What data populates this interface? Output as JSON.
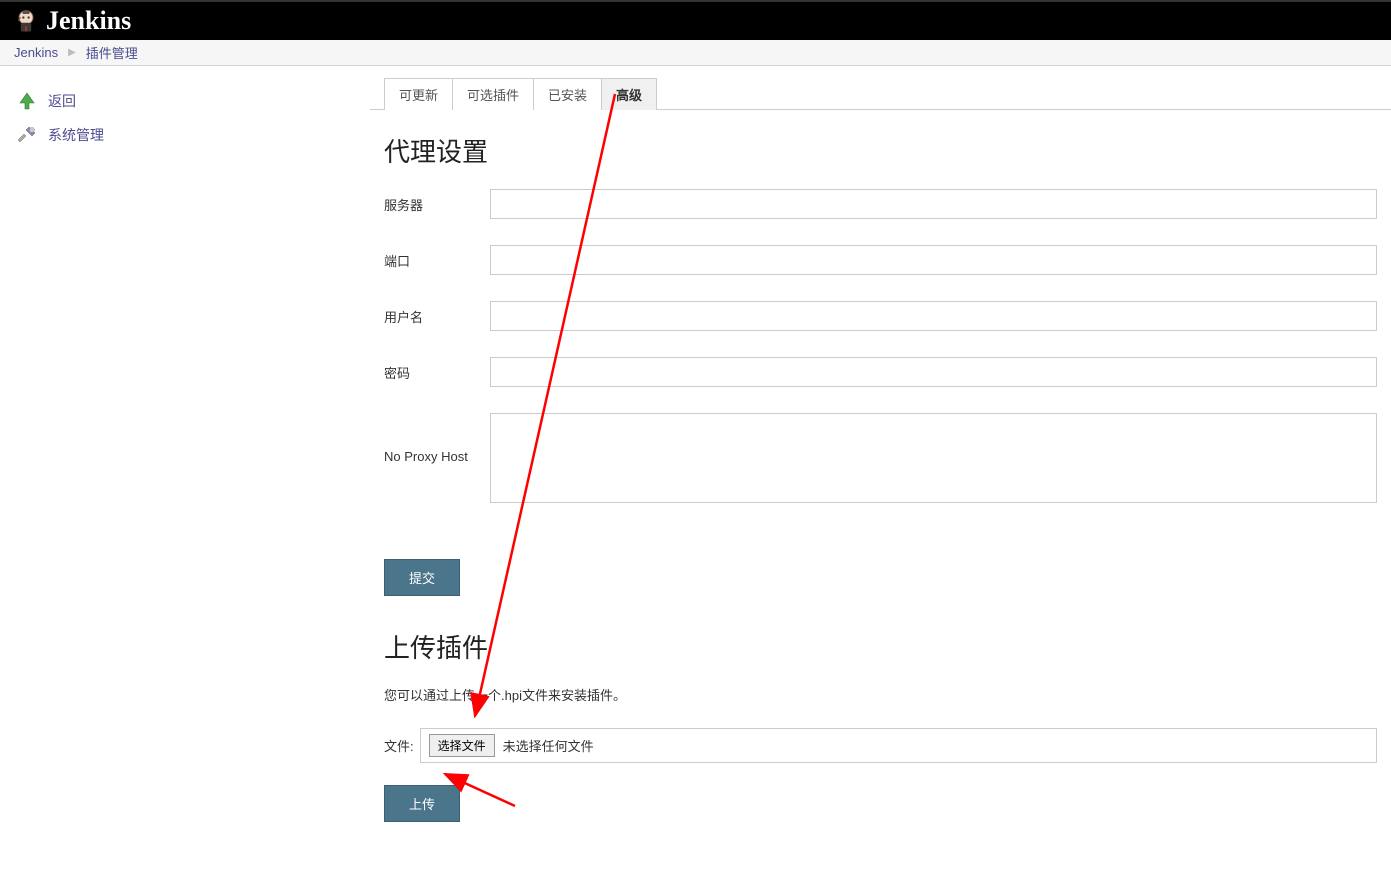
{
  "header": {
    "app_name": "Jenkins"
  },
  "breadcrumb": {
    "root": "Jenkins",
    "current": "插件管理"
  },
  "sidebar": {
    "items": [
      {
        "label": "返回"
      },
      {
        "label": "系统管理"
      }
    ]
  },
  "tabs": {
    "items": [
      {
        "label": "可更新"
      },
      {
        "label": "可选插件"
      },
      {
        "label": "已安装"
      },
      {
        "label": "高级"
      }
    ]
  },
  "proxy_section": {
    "title": "代理设置",
    "server_label": "服务器",
    "port_label": "端口",
    "username_label": "用户名",
    "password_label": "密码",
    "no_proxy_label": "No Proxy Host",
    "server_value": "",
    "port_value": "",
    "username_value": "",
    "password_value": "",
    "no_proxy_value": "",
    "submit_label": "提交"
  },
  "upload_section": {
    "title": "上传插件",
    "description": "您可以通过上传一个.hpi文件来安装插件。",
    "file_label": "文件:",
    "choose_file_label": "选择文件",
    "no_file_text": "未选择任何文件",
    "upload_label": "上传"
  }
}
